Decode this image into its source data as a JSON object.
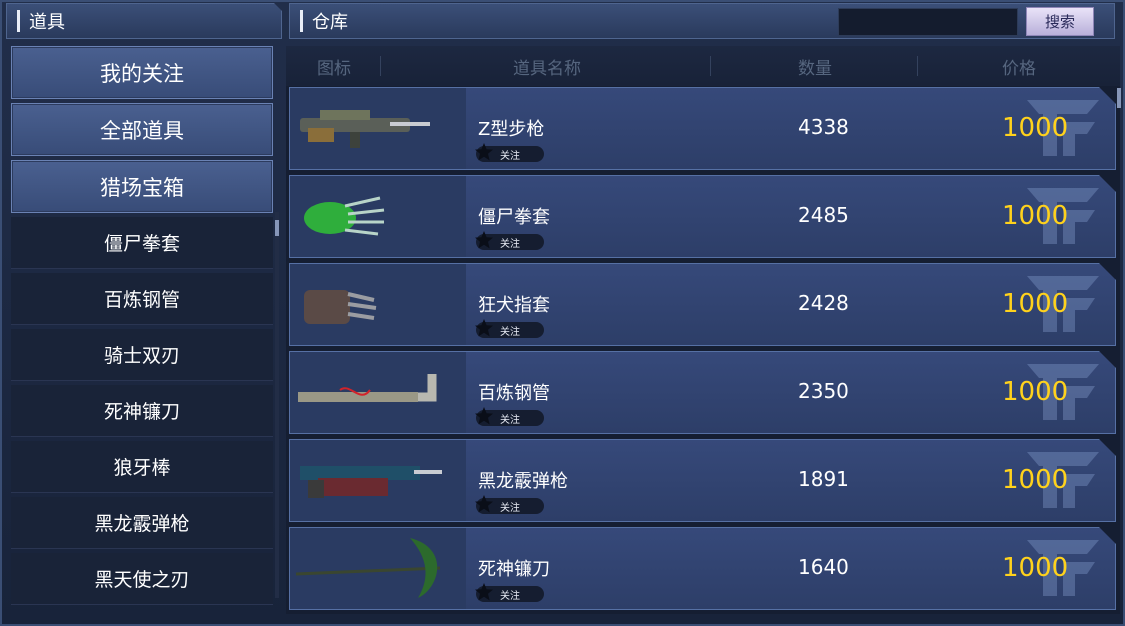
{
  "left_header": {
    "title": "道具"
  },
  "right_header": {
    "title": "仓库",
    "search_button": "搜索",
    "search_value": ""
  },
  "nav": {
    "categories": [
      {
        "label": "我的关注"
      },
      {
        "label": "全部道具"
      },
      {
        "label": "猎场宝箱"
      }
    ],
    "items": [
      {
        "label": "僵尸拳套"
      },
      {
        "label": "百炼钢管"
      },
      {
        "label": "骑士双刃"
      },
      {
        "label": "死神镰刀"
      },
      {
        "label": "狼牙棒"
      },
      {
        "label": "黑龙霰弹枪"
      },
      {
        "label": "黑天使之刃"
      }
    ]
  },
  "table": {
    "headers": {
      "icon": "图标",
      "name": "道具名称",
      "qty": "数量",
      "price": "价格"
    },
    "rows": [
      {
        "name": "Z型步枪",
        "fav": "关注",
        "qty": "4338",
        "price": "1000",
        "icon": "rifle-icon"
      },
      {
        "name": "僵尸拳套",
        "fav": "关注",
        "qty": "2485",
        "price": "1000",
        "icon": "zombie-glove-icon"
      },
      {
        "name": "狂犬指套",
        "fav": "关注",
        "qty": "2428",
        "price": "1000",
        "icon": "knuckle-icon"
      },
      {
        "name": "百炼钢管",
        "fav": "关注",
        "qty": "2350",
        "price": "1000",
        "icon": "steel-pipe-icon"
      },
      {
        "name": "黑龙霰弹枪",
        "fav": "关注",
        "qty": "1891",
        "price": "1000",
        "icon": "shotgun-icon"
      },
      {
        "name": "死神镰刀",
        "fav": "关注",
        "qty": "1640",
        "price": "1000",
        "icon": "scythe-icon"
      }
    ]
  },
  "colors": {
    "price": "#ffd21c",
    "accent": "#5670a4"
  }
}
